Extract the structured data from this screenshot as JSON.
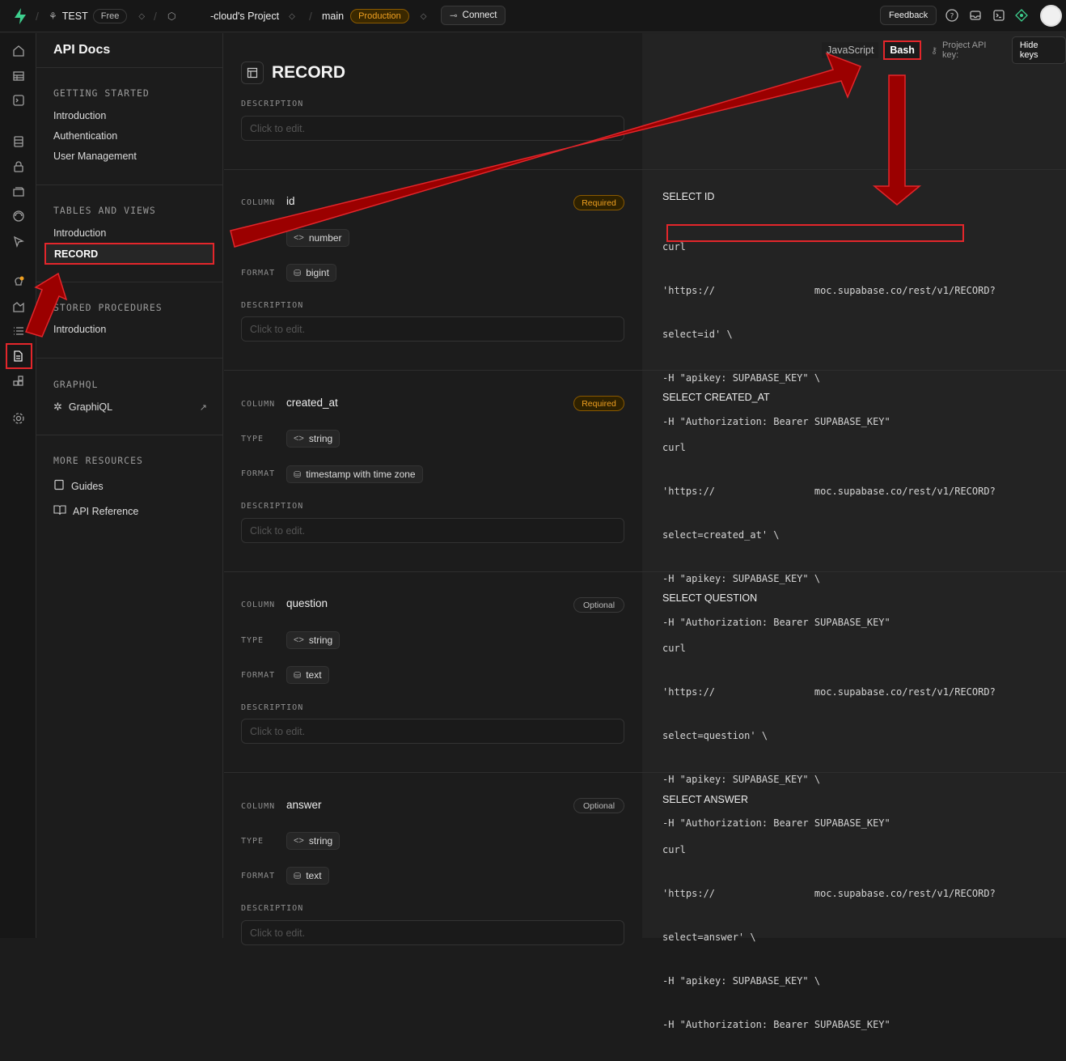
{
  "topbar": {
    "org_name": "TEST",
    "plan": "Free",
    "project_name": "-cloud's Project",
    "branch": "main",
    "env_badge": "Production",
    "connect_label": "Connect",
    "feedback_label": "Feedback"
  },
  "sidebar": {
    "title": "API Docs",
    "getting_started": {
      "heading": "GETTING STARTED",
      "items": [
        "Introduction",
        "Authentication",
        "User Management"
      ]
    },
    "tables_views": {
      "heading": "TABLES AND VIEWS",
      "items": [
        "Introduction",
        "RECORD"
      ]
    },
    "stored_procedures": {
      "heading": "STORED PROCEDURES",
      "items": [
        "Introduction"
      ]
    },
    "graphql": {
      "heading": "GRAPHQL",
      "items": [
        "GraphiQL"
      ]
    },
    "more_resources": {
      "heading": "MORE RESOURCES",
      "items": [
        "Guides",
        "API Reference"
      ]
    }
  },
  "main": {
    "table_title": "RECORD",
    "description_label": "DESCRIPTION",
    "placeholder": "Click to edit.",
    "column_label": "COLUMN",
    "type_label": "TYPE",
    "format_label": "FORMAT",
    "columns": [
      {
        "name": "id",
        "badge": "Required",
        "type": "number",
        "format": "bigint"
      },
      {
        "name": "created_at",
        "badge": "Required",
        "type": "string",
        "format": "timestamp with time zone"
      },
      {
        "name": "question",
        "badge": "Optional",
        "type": "string",
        "format": "text"
      },
      {
        "name": "answer",
        "badge": "Optional",
        "type": "string",
        "format": "text"
      }
    ]
  },
  "code": {
    "tab_js": "JavaScript",
    "tab_bash": "Bash",
    "api_key_label": "Project API key:",
    "hide_keys": "Hide keys",
    "snippets": [
      {
        "title": "SELECT ID",
        "lines": [
          "curl",
          "'https://                 moc.supabase.co/rest/v1/RECORD?",
          "select=id' \\",
          "-H \"apikey: SUPABASE_KEY\" \\",
          "-H \"Authorization: Bearer SUPABASE_KEY\""
        ]
      },
      {
        "title": "SELECT CREATED_AT",
        "lines": [
          "curl",
          "'https://                 moc.supabase.co/rest/v1/RECORD?",
          "select=created_at' \\",
          "-H \"apikey: SUPABASE_KEY\" \\",
          "-H \"Authorization: Bearer SUPABASE_KEY\""
        ]
      },
      {
        "title": "SELECT QUESTION",
        "lines": [
          "curl",
          "'https://                 moc.supabase.co/rest/v1/RECORD?",
          "select=question' \\",
          "-H \"apikey: SUPABASE_KEY\" \\",
          "-H \"Authorization: Bearer SUPABASE_KEY\""
        ]
      },
      {
        "title": "SELECT ANSWER",
        "lines": [
          "curl",
          "'https://                 moc.supabase.co/rest/v1/RECORD?",
          "select=answer' \\",
          "-H \"apikey: SUPABASE_KEY\" \\",
          "-H \"Authorization: Bearer SUPABASE_KEY\""
        ]
      }
    ]
  },
  "colors": {
    "accent_brand": "#3ecf8e",
    "annotation_red": "#e3262b",
    "arrow_fill": "#9b0000",
    "warning": "#f0a020"
  }
}
